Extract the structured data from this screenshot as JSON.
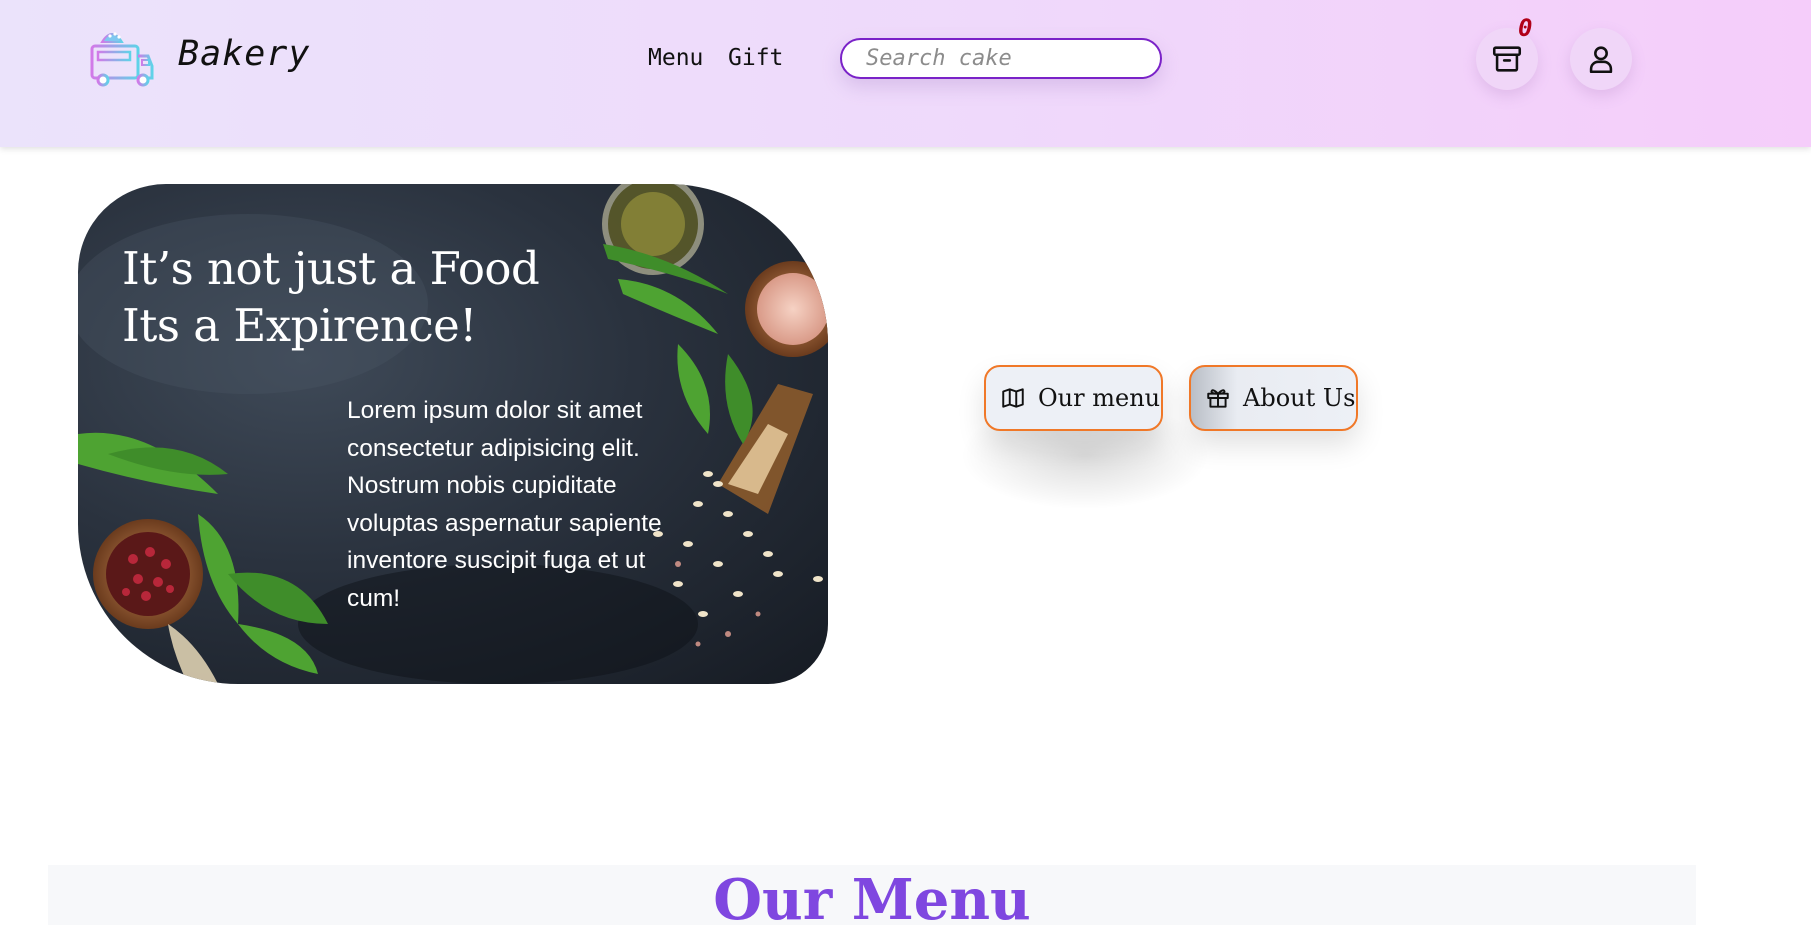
{
  "header": {
    "brand": "Bakery",
    "logo_icon": "food-truck-icon",
    "nav": [
      {
        "label": "Menu"
      },
      {
        "label": "Gift"
      }
    ],
    "search": {
      "placeholder": "Search cake",
      "value": ""
    },
    "cart": {
      "icon": "shopping-box-icon",
      "count": "0"
    },
    "account": {
      "icon": "user-icon"
    },
    "gradient_colors": [
      "#ebe3fb",
      "#f5cdfa"
    ]
  },
  "hero": {
    "title_line1": "It’s not just a Food",
    "title_line2": "Its a Expirence!",
    "description": "Lorem ipsum dolor sit amet consectetur adipisicing elit. Nostrum nobis cupiditate voluptas aspernatur sapiente inventore suscipit fuga et ut cum!"
  },
  "actions": [
    {
      "label": "Our menu",
      "icon": "map-icon"
    },
    {
      "label": "About Us",
      "icon": "gift-icon"
    }
  ],
  "menu_section": {
    "title": "Our Menu",
    "title_color": "#7f47e0"
  },
  "colors": {
    "accent_border": "#f07828",
    "search_border": "#7a22c8",
    "cart_count": "#b00018"
  }
}
